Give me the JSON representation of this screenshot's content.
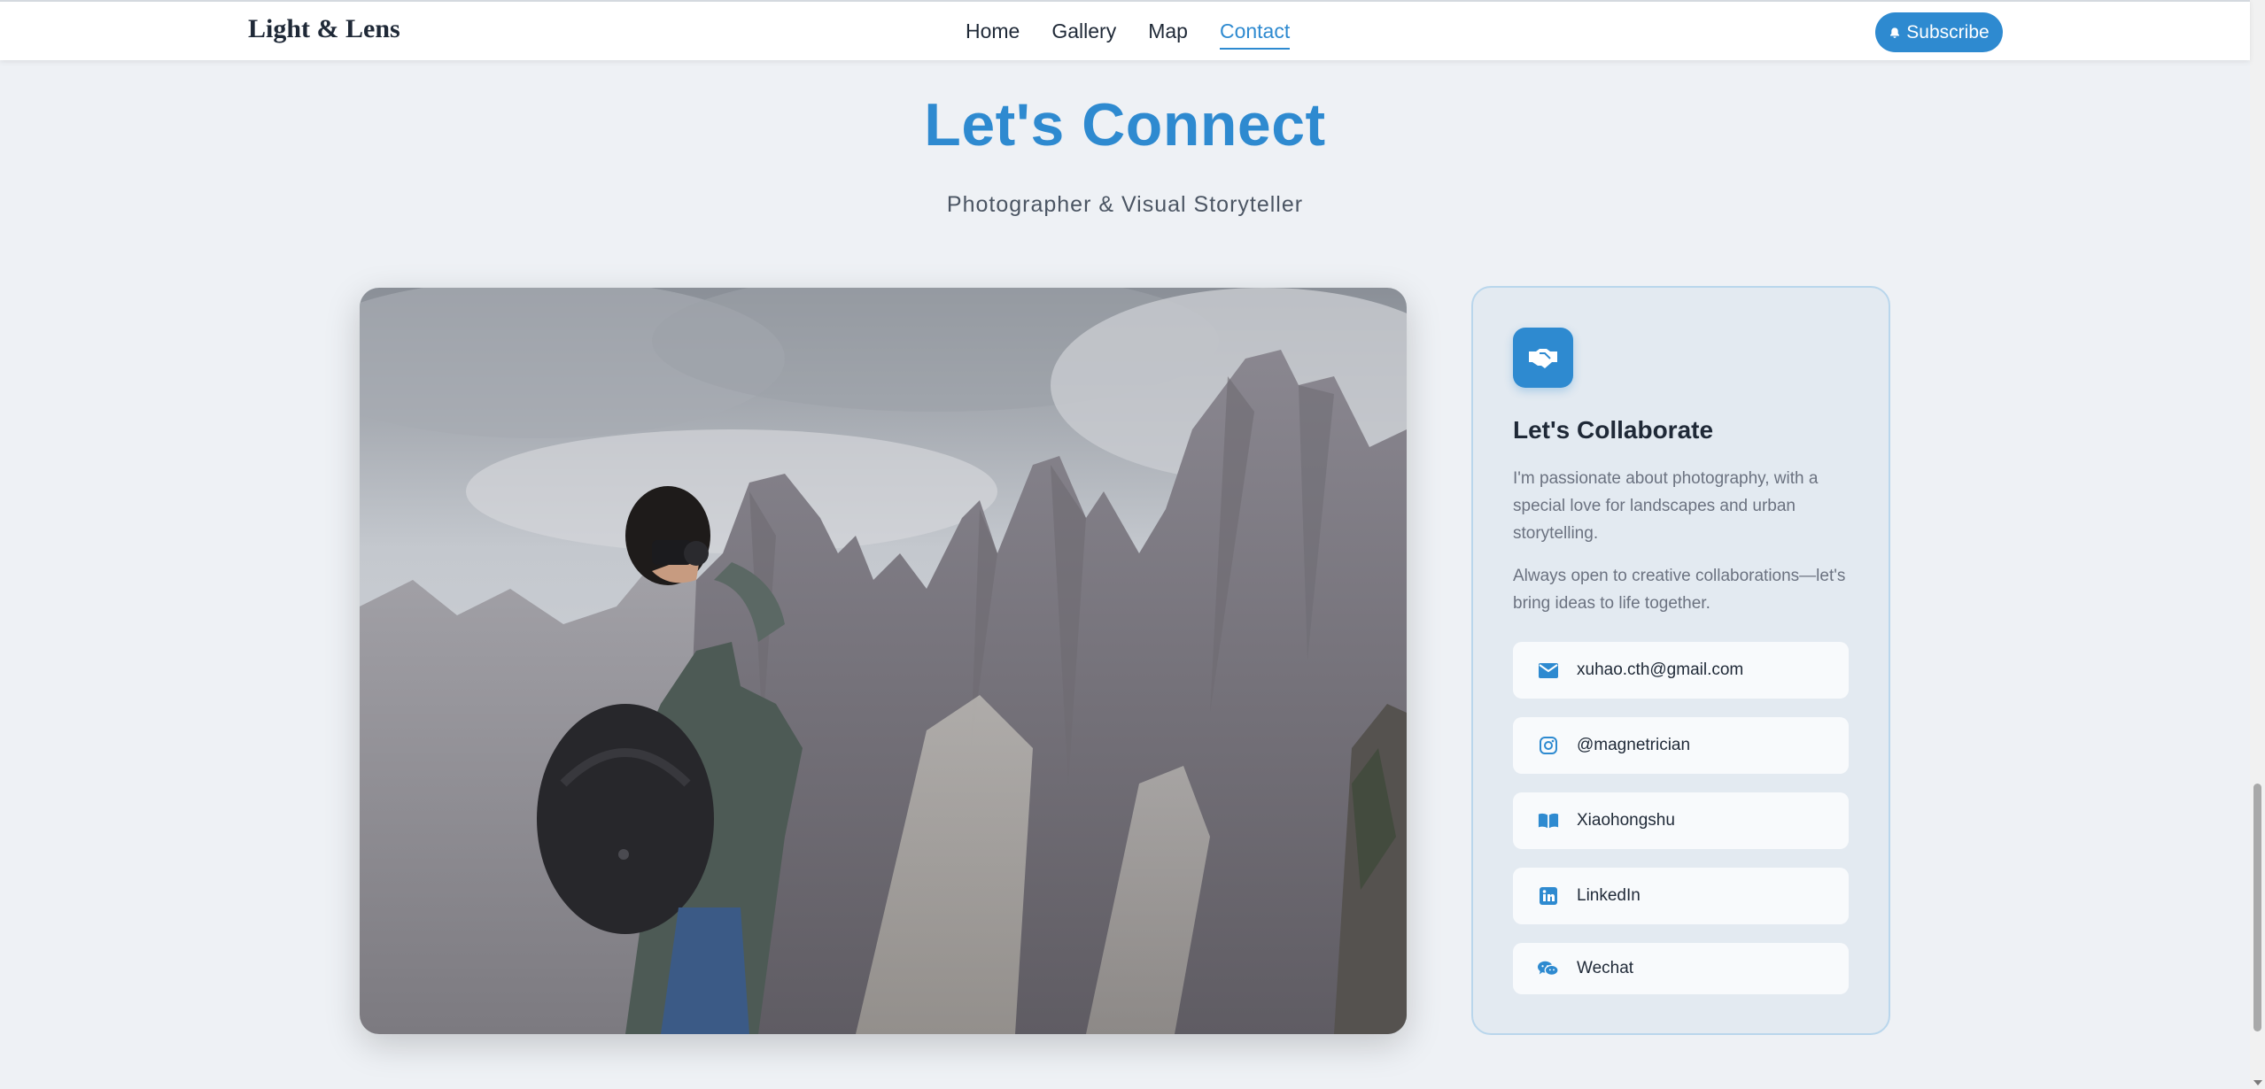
{
  "nav": {
    "brand": "Light & Lens",
    "links": [
      "Home",
      "Gallery",
      "Map",
      "Contact"
    ],
    "active": "Contact",
    "subscribe_label": "Subscribe"
  },
  "hero": {
    "title": "Let's Connect",
    "subtitle": "Photographer & Visual Storyteller"
  },
  "card": {
    "title": "Let's Collaborate",
    "paragraph1": "I'm passionate about photography, with a special love for landscapes and urban storytelling.",
    "paragraph2": "Always open to creative collaborations—let's bring ideas to life together.",
    "contacts": [
      {
        "label": "xuhao.cth@gmail.com",
        "icon": "envelope-icon"
      },
      {
        "label": "@magnetrician",
        "icon": "instagram-icon"
      },
      {
        "label": "Xiaohongshu",
        "icon": "book-icon"
      },
      {
        "label": "LinkedIn",
        "icon": "linkedin-icon"
      },
      {
        "label": "Wechat",
        "icon": "wechat-icon"
      }
    ]
  },
  "colors": {
    "accent": "#2e8ad0",
    "card_background": "#e3eaf1",
    "page_background": "#eef1f5"
  }
}
